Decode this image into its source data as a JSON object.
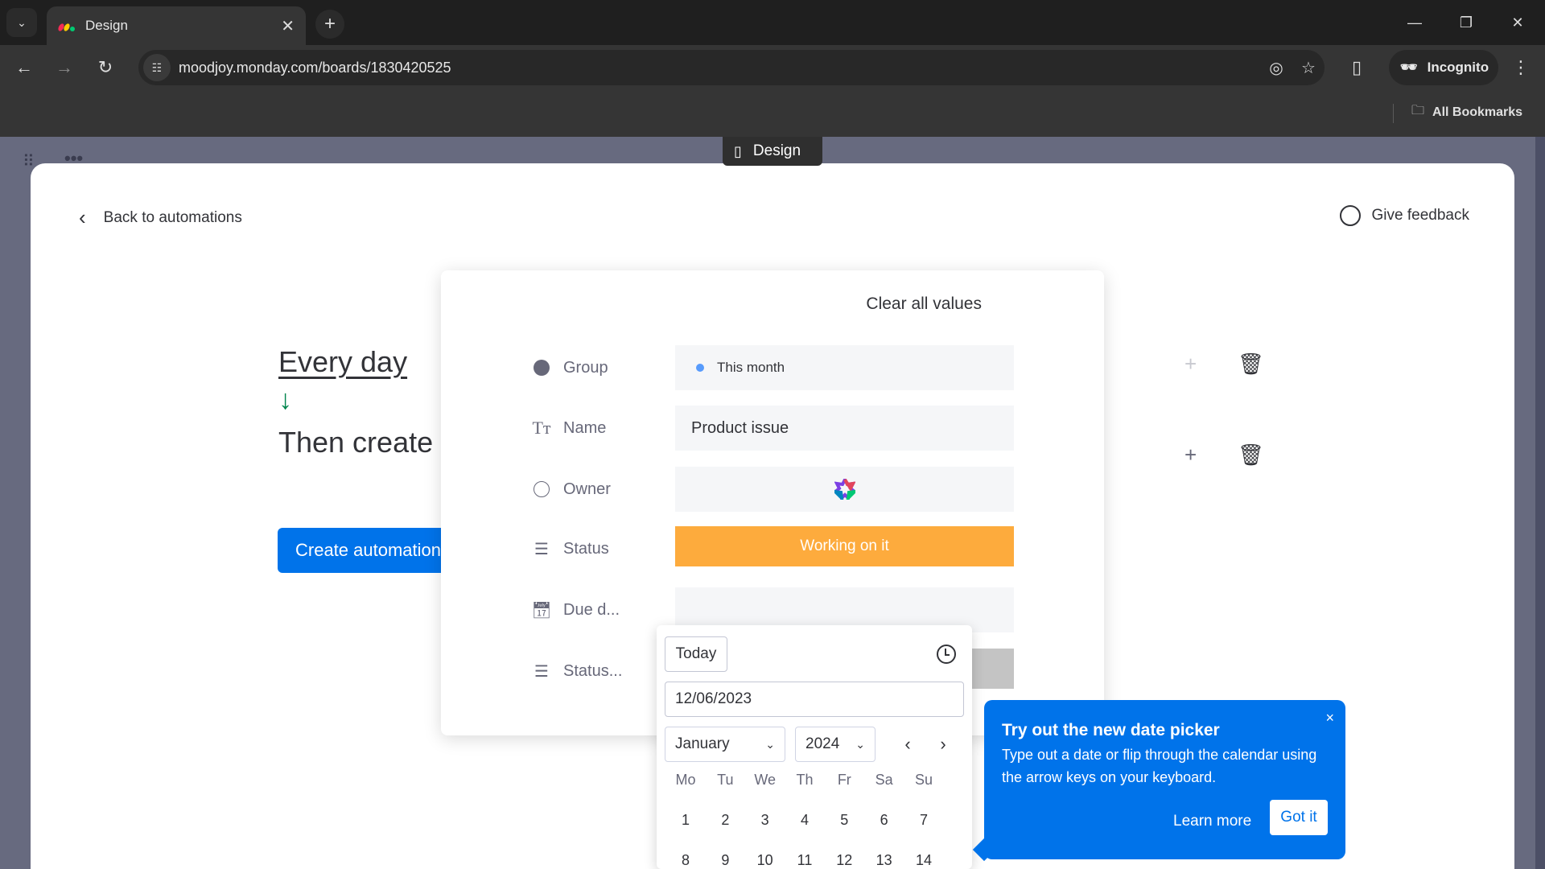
{
  "browser": {
    "tab_title": "Design",
    "url": "moodjoy.monday.com/boards/1830420525",
    "incognito_label": "Incognito",
    "bookmarks_label": "All Bookmarks"
  },
  "app": {
    "view_pill": "Design"
  },
  "modal": {
    "back_label": "Back to automations",
    "feedback_label": "Give feedback",
    "sentence": {
      "trigger": "Every day",
      "action": "Then create",
      "arrow": "↓"
    },
    "create_button": "Create automation"
  },
  "card": {
    "clear_all": "Clear all values",
    "fields": [
      {
        "label": "Group",
        "icon": "group-dot-icon",
        "value": "This month",
        "value_dot_color": "#579bfc"
      },
      {
        "label": "Name",
        "icon": "text-icon",
        "value": "Product issue"
      },
      {
        "label": "Owner",
        "icon": "people-icon",
        "value": ""
      },
      {
        "label": "Status",
        "icon": "status-lines-icon",
        "value": "Working on it",
        "value_color": "#fdab3d"
      },
      {
        "label": "Due d...",
        "icon": "calendar-icon",
        "value": ""
      },
      {
        "label": "Status...",
        "icon": "status-lines-icon",
        "value": ""
      }
    ]
  },
  "datepicker": {
    "today_label": "Today",
    "date_value": "12/06/2023",
    "month": "January",
    "year": "2024",
    "weekdays": [
      "Mo",
      "Tu",
      "We",
      "Th",
      "Fr",
      "Sa",
      "Su"
    ],
    "weeks": [
      [
        "1",
        "2",
        "3",
        "4",
        "5",
        "6",
        "7"
      ],
      [
        "8",
        "9",
        "10",
        "11",
        "12",
        "13",
        "14"
      ]
    ]
  },
  "tooltip": {
    "title": "Try out the new date picker",
    "body": "Type out a date or flip through the calendar using the arrow keys on your keyboard.",
    "learn_more": "Learn more",
    "got_it": "Got it",
    "close": "×"
  },
  "colors": {
    "primary": "#0073ea",
    "status_working": "#fdab3d",
    "success_arrow": "#00854d"
  }
}
